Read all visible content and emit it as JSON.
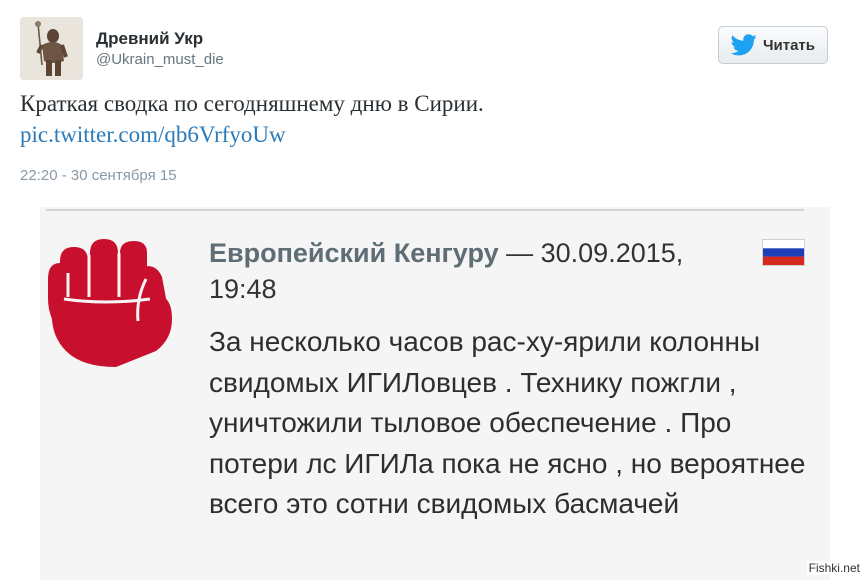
{
  "tweet": {
    "author_name": "Древний Укр",
    "author_handle": "@Ukrain_must_die",
    "follow_label": "Читать",
    "text": "Краткая сводка по сегодняшнему дню в Сирии.",
    "link": "pic.twitter.com/qb6VrfyoUw",
    "timestamp": "22:20 - 30 сентября 15"
  },
  "embedded": {
    "author": "Европейский Кенгуру",
    "date": "— 30.09.2015,",
    "time": "19:48",
    "body": "За несколько часов рас-ху-ярили колонны свидомых ИГИЛовцев . Технику пожгли , уничтожили тыловое обеспечение . Про потери лс ИГИЛа пока не ясно , но вероятнее всего это сотни свидомых басмачей"
  },
  "icons": {
    "avatar": "avatar-photo",
    "follow": "twitter-bird-icon",
    "embedded_avatar": "fist-icon",
    "flag": "russian-flag-icon"
  },
  "colors": {
    "link": "#2b7bb9",
    "twitter_blue": "#1da1f2",
    "fist_red": "#c8102e"
  },
  "watermark": "Fishki.net"
}
